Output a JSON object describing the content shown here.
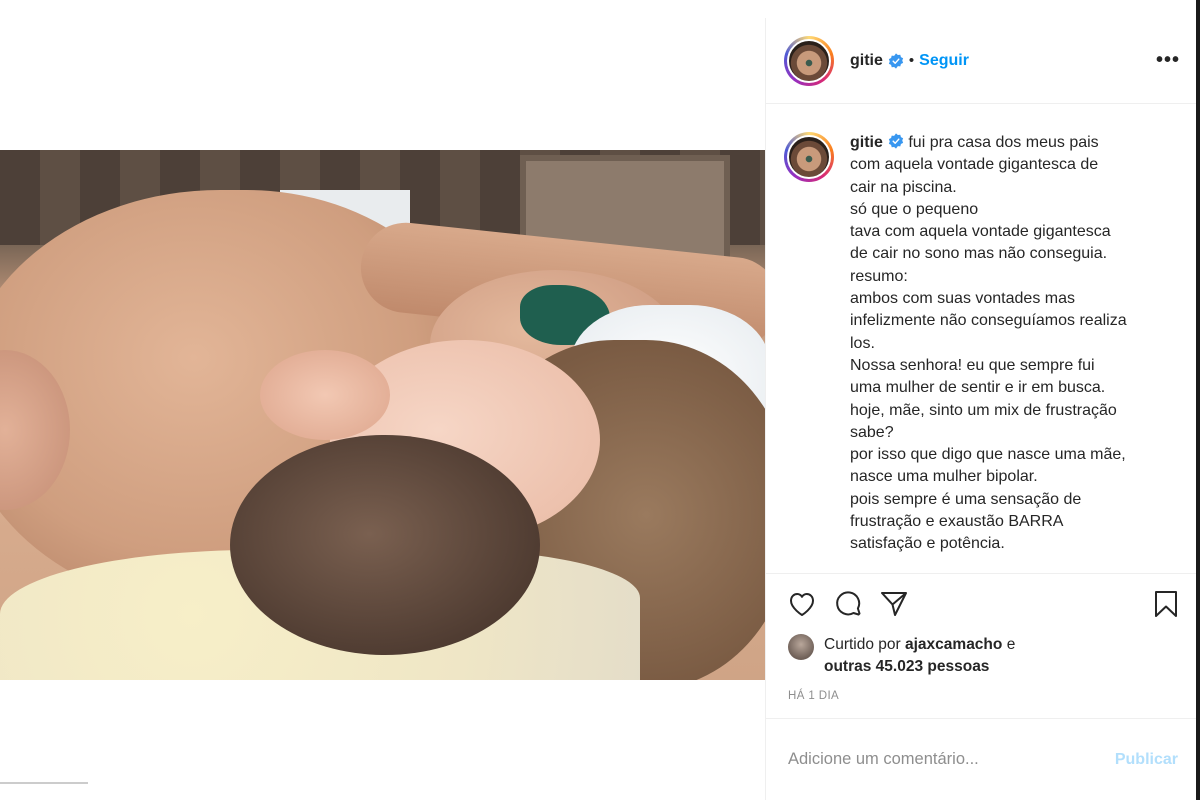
{
  "post": {
    "username": "gitie",
    "verified": true,
    "separator": "•",
    "follow_label": "Seguir",
    "more_label": "•••",
    "caption_lines": [
      "fui pra casa dos meus pais",
      "com aquela vontade gigantesca de",
      "cair na piscina.",
      "só que o pequeno",
      "tava com aquela vontade gigantesca",
      "de cair no sono mas não conseguia.",
      "resumo:",
      "ambos com suas vontades mas",
      "infelizmente não conseguíamos realiza",
      "los.",
      "Nossa senhora! eu que sempre fui",
      "uma mulher de sentir e ir em busca.",
      "hoje, mãe, sinto um mix de frustração",
      "sabe?",
      "por isso que digo que nasce uma mãe,",
      "nasce uma mulher bipolar.",
      "pois sempre é uma sensação de",
      "frustração e exaustão BARRA",
      "satisfação e potência."
    ],
    "likes": {
      "prefix": "Curtido por",
      "liker": "ajaxcamacho",
      "connector": "e",
      "others": "outras 45.023 pessoas"
    },
    "timestamp": "HÁ 1 DIA",
    "comment": {
      "placeholder": "Adicione um comentário...",
      "value": "",
      "publish_label": "Publicar"
    },
    "icons": {
      "like": "heart-icon",
      "comment": "comment-icon",
      "share": "share-icon",
      "save": "bookmark-icon"
    },
    "colors": {
      "accent": "#0095f6",
      "publish_disabled": "#b2dffc",
      "muted": "#8e8e8e",
      "text": "#262626",
      "verified": "#3897f0"
    }
  }
}
